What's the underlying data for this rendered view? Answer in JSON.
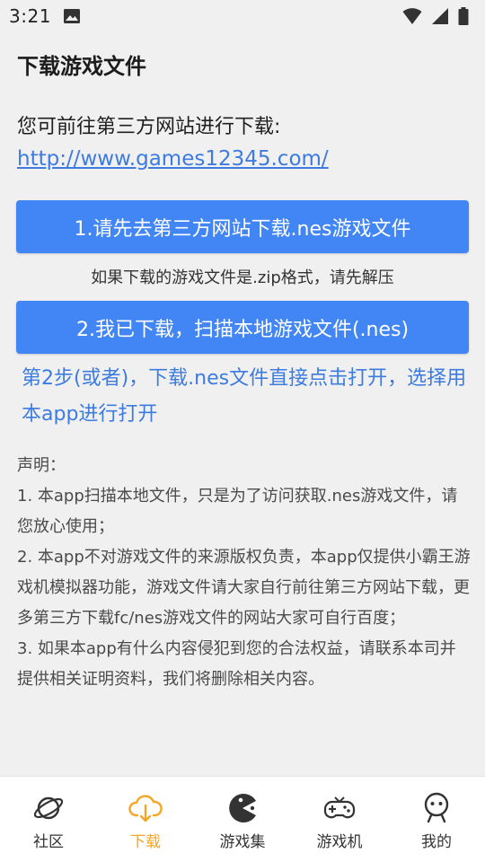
{
  "status_bar": {
    "time": "3:21"
  },
  "page": {
    "title": "下载游戏文件",
    "intro": "您可前往第三方网站进行下载:",
    "link": "http://www.games12345.com/"
  },
  "actions": {
    "download_button": "1.请先去第三方网站下载.nes游戏文件",
    "zip_hint": "如果下载的游戏文件是.zip格式，请先解压",
    "scan_button": "2.我已下载，扫描本地游戏文件(.nes)"
  },
  "step2_tip": "第2步(或者)，下载.nes文件直接点击打开，选择用本app进行打开",
  "disclaimer": {
    "heading": "声明：",
    "items": [
      "1. 本app扫描本地文件，只是为了访问获取.nes游戏文件，请您放心使用；",
      "2. 本app不对游戏文件的来源版权负责，本app仅提供小霸王游戏机模拟器功能，游戏文件请大家自行前往第三方网站下载，更多第三方下载fc/nes游戏文件的网站大家可自行百度；",
      "3. 如果本app有什么内容侵犯到您的合法权益，请联系本司并提供相关证明资料，我们将删除相关内容。"
    ]
  },
  "bottom_nav": {
    "items": [
      {
        "label": "社区",
        "icon": "planet-icon"
      },
      {
        "label": "下载",
        "icon": "cloud-download-icon",
        "active": true
      },
      {
        "label": "游戏集",
        "icon": "pacman-icon"
      },
      {
        "label": "游戏机",
        "icon": "gamepad-icon"
      },
      {
        "label": "我的",
        "icon": "profile-icon"
      }
    ]
  },
  "colors": {
    "accent": "#4285f4",
    "link": "#3d7be0",
    "active_nav": "#f5a623",
    "background": "#f0f0f0"
  }
}
